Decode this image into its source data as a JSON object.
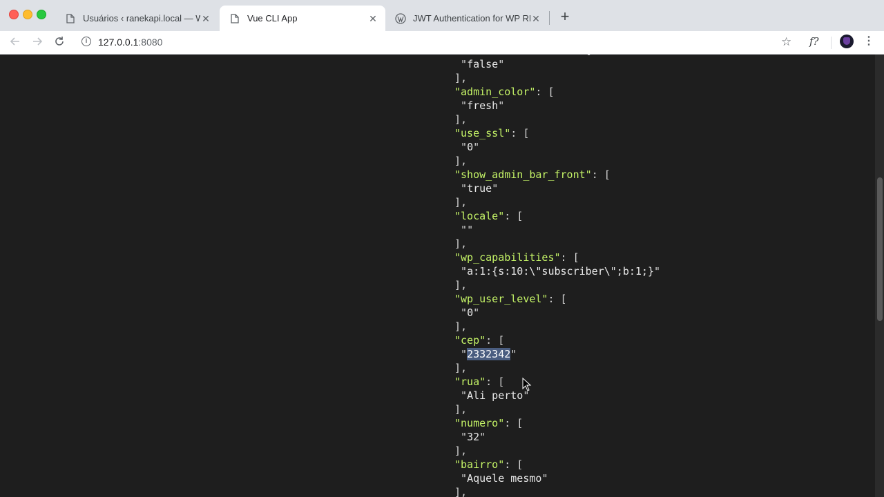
{
  "browser": {
    "tabs": [
      {
        "title": "Usuários ‹ ranekapi.local — Wo",
        "icon": "page-icon"
      },
      {
        "title": "Vue CLI App",
        "icon": "page-icon"
      },
      {
        "title": "JWT Authentication for WP RES",
        "icon": "wordpress-icon"
      }
    ],
    "close_glyph": "✕",
    "new_tab_glyph": "+",
    "url_host": "127.0.0.1",
    "url_port": ":8080",
    "ext_label": "f?"
  },
  "json_view": {
    "top_partial": "\"comment_shortcuts\": [",
    "entries": [
      {
        "key": "comment_shortcuts",
        "value": "false"
      },
      {
        "key": "admin_color",
        "value": "fresh"
      },
      {
        "key": "use_ssl",
        "value": "0"
      },
      {
        "key": "show_admin_bar_front",
        "value": "true"
      },
      {
        "key": "locale",
        "value": ""
      },
      {
        "key": "wp_capabilities",
        "value": "a:1:{s:10:\\\"subscriber\\\";b:1;}"
      },
      {
        "key": "wp_user_level",
        "value": "0"
      },
      {
        "key": "cep",
        "value": "2332342",
        "selected": true
      },
      {
        "key": "rua",
        "value": "Ali perto"
      },
      {
        "key": "numero",
        "value": "32"
      },
      {
        "key": "bairro",
        "value": "Aquele mesmo"
      }
    ]
  }
}
